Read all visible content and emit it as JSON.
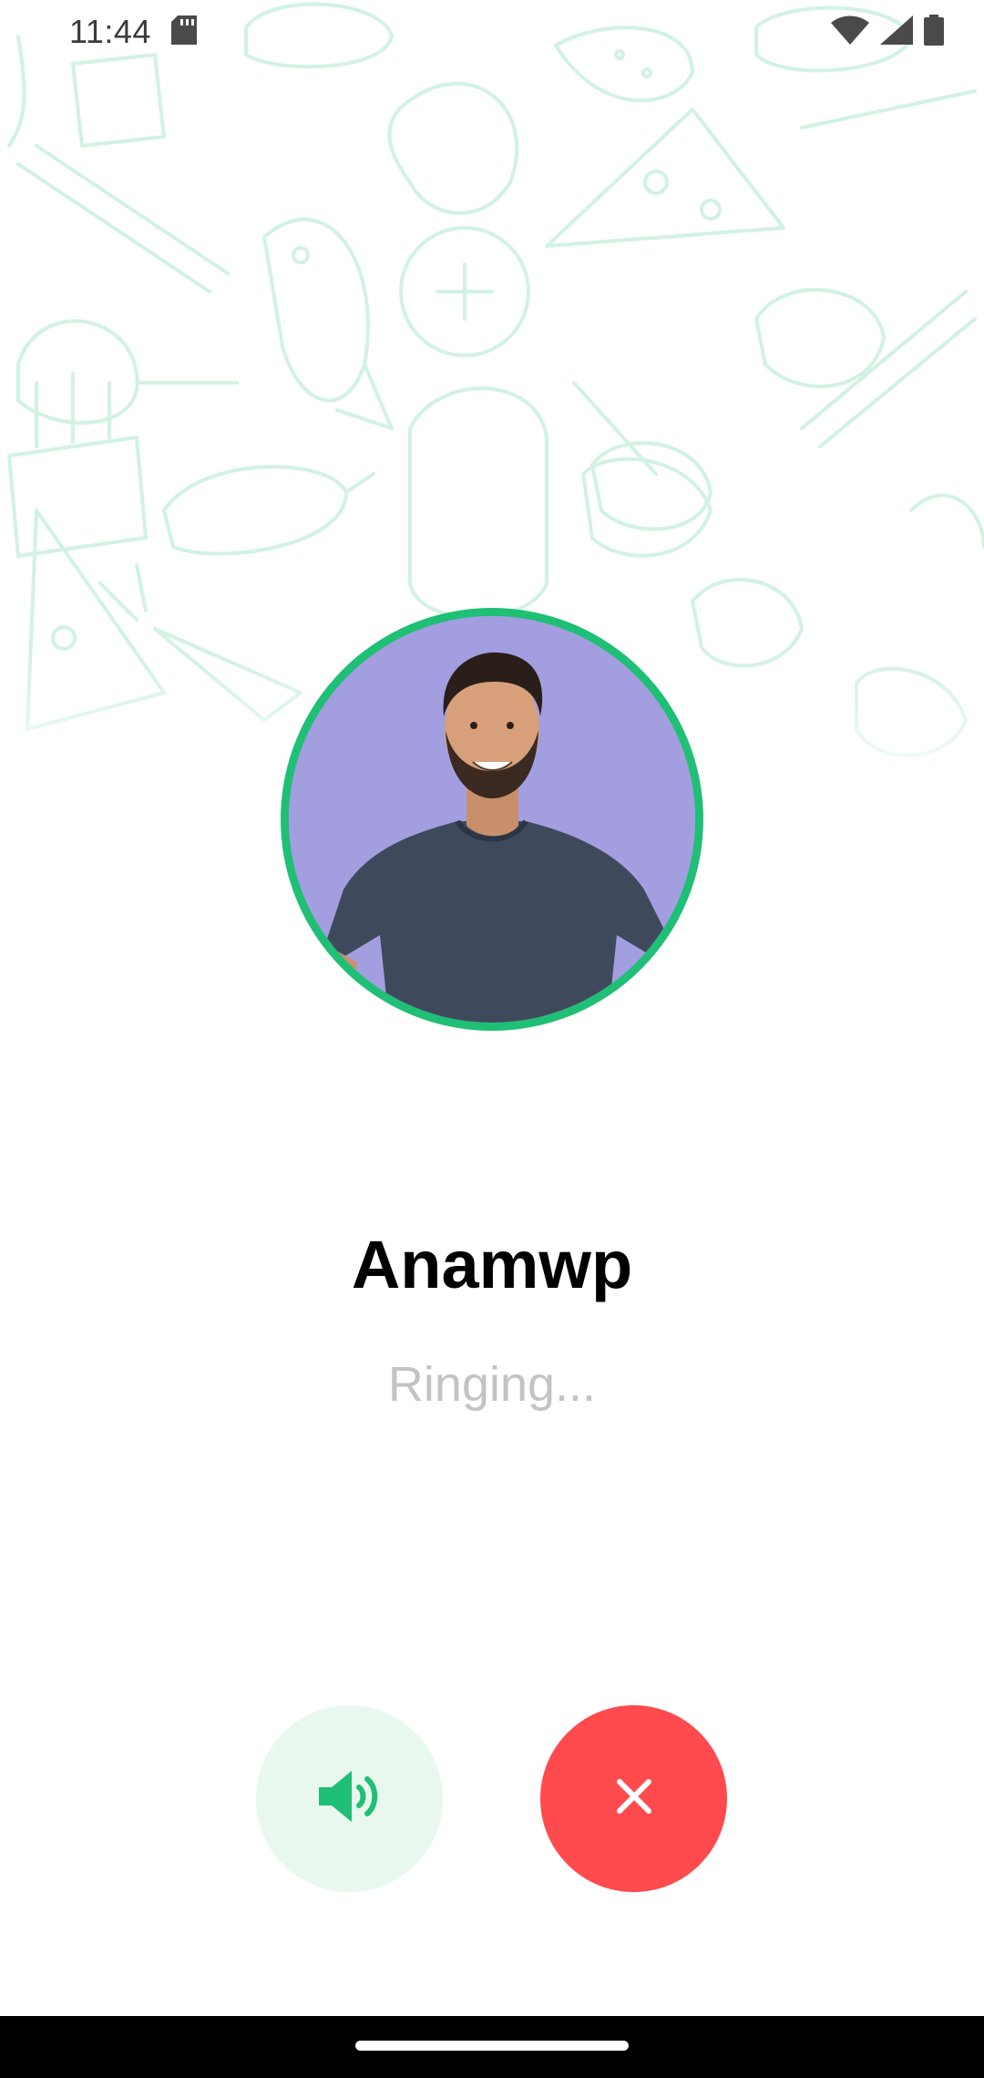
{
  "status_bar": {
    "time": "11:44",
    "icons": [
      "sd-card-icon",
      "wifi-icon",
      "cellular-signal-icon",
      "battery-icon"
    ]
  },
  "caller": {
    "name": "Anamwp",
    "status": "Ringing...",
    "avatar": "caller-avatar-photo"
  },
  "controls": {
    "speaker": {
      "icon": "speaker-volume-icon"
    },
    "end_call": {
      "icon": "close-icon"
    }
  },
  "colors": {
    "accent_green": "#1fbf75",
    "speaker_bg": "#e8f8ee",
    "end_call_red": "#ff4a4e",
    "status_text": "#c3c3c3",
    "pattern": "#d2f2e2"
  }
}
